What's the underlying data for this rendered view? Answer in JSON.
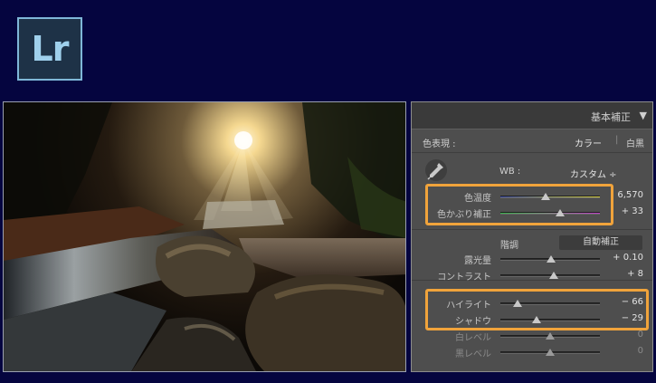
{
  "logo": {
    "text": "Lr"
  },
  "panel": {
    "title": "基本補正",
    "toggle": "▼",
    "profile": {
      "label": "色表現 :",
      "opt_color": "カラー",
      "divider": "|",
      "opt_bw": "白黒"
    },
    "wb": {
      "label": "WB :",
      "value": "カスタム ÷"
    },
    "tone_label": "階調",
    "auto_button": "自動補正",
    "sliders": [
      {
        "label": "色温度",
        "value": "6,570",
        "level": 0.45,
        "track": "temp"
      },
      {
        "label": "色かぶり補正",
        "value": "+ 33",
        "level": 0.6,
        "track": "tint"
      },
      {
        "label": "露光量",
        "value": "+ 0.10",
        "level": 0.51,
        "track": "plain"
      },
      {
        "label": "コントラスト",
        "value": "+ 8",
        "level": 0.54,
        "track": "plain"
      },
      {
        "label": "ハイライト",
        "value": "− 66",
        "level": 0.17,
        "track": "plain"
      },
      {
        "label": "シャドウ",
        "value": "− 29",
        "level": 0.36,
        "track": "plain"
      },
      {
        "label": "白レベル",
        "value": "0",
        "level": 0.5,
        "track": "plain"
      },
      {
        "label": "黒レベル",
        "value": "0",
        "level": 0.5,
        "track": "plain"
      }
    ]
  },
  "colors": {
    "background": "#05053f",
    "highlight": "#f0a33b",
    "panel": "#4e4e4e"
  },
  "icons": {
    "eyedropper": "eyedropper-icon",
    "toggle": "triangle-down-icon"
  }
}
